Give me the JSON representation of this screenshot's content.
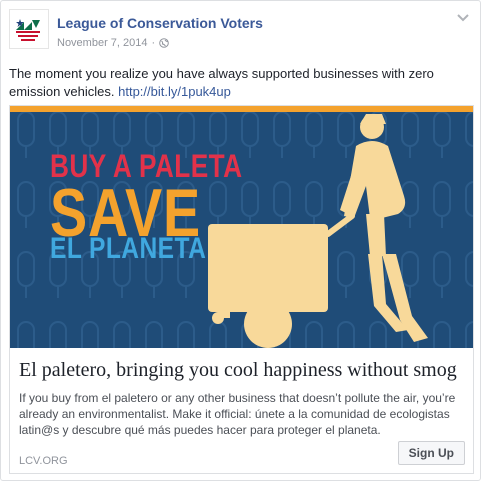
{
  "post": {
    "author": "League of Conservation Voters",
    "date": "November 7, 2014",
    "separator": "·",
    "text": "The moment you realize you have always supported businesses with zero emission vehicles.",
    "link": "http://bit.ly/1puk4up"
  },
  "hero": {
    "line1": "BUY A PALETA",
    "line2": "SAVE",
    "line3": "EL PLANETA",
    "colors": {
      "background": "#1f4c78",
      "line1": "#e2324a",
      "line2": "#f4a22d",
      "line3": "#40a8df",
      "figure": "#f8d99a"
    }
  },
  "card": {
    "title": "El paletero, bringing you cool happiness without smog",
    "description": "If you buy from el paletero or any other business that doesn’t pollute the air, you’re already an environmentalist. Make it official: únete a la comunidad de ecologistas latin@s y descubre qué más puedes hacer para proteger el planeta.",
    "domain": "LCV.ORG",
    "cta": "Sign Up"
  },
  "icons": {
    "avatar": "lcv-logo",
    "privacy": "globe-icon",
    "menu": "chevron-down-icon"
  }
}
